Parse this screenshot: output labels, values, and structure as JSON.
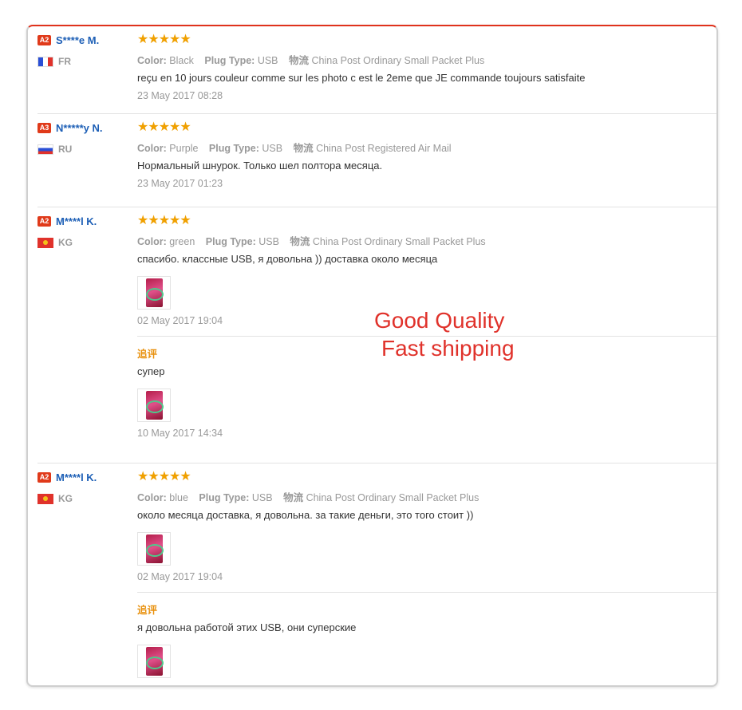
{
  "reviews": [
    {
      "level": "A2",
      "name": "S****e M.",
      "country": "FR",
      "flag": "fr",
      "stars": "★★★★★",
      "color_label": "Color:",
      "color": "Black",
      "plug_label": "Plug Type:",
      "plug": "USB",
      "ship_label": "物流",
      "ship": "China Post Ordinary Small Packet Plus",
      "text": "reçu en 10 jours couleur comme sur les photo c est le 2eme que JE commande toujours satisfaite",
      "date": "23 May 2017 08:28"
    },
    {
      "level": "A3",
      "name": "N*****y N.",
      "country": "RU",
      "flag": "ru",
      "stars": "★★★★★",
      "color_label": "Color:",
      "color": "Purple",
      "plug_label": "Plug Type:",
      "plug": "USB",
      "ship_label": "物流",
      "ship": "China Post Registered Air Mail",
      "text": "Нормальный шнурок. Только шел полтора месяца.",
      "date": "23 May 2017 01:23"
    },
    {
      "level": "A2",
      "name": "M****l K.",
      "country": "KG",
      "flag": "kg",
      "stars": "★★★★★",
      "color_label": "Color:",
      "color": "green",
      "plug_label": "Plug Type:",
      "plug": "USB",
      "ship_label": "物流",
      "ship": "China Post Ordinary Small Packet Plus",
      "text": "спасибо. классные USB, я довольна )) доставка около месяца",
      "date": "02 May 2017 19:04",
      "followup": {
        "label": "追评",
        "text": "супер",
        "date": "10 May 2017 14:34"
      }
    },
    {
      "level": "A2",
      "name": "M****l K.",
      "country": "KG",
      "flag": "kg",
      "stars": "★★★★★",
      "color_label": "Color:",
      "color": "blue",
      "plug_label": "Plug Type:",
      "plug": "USB",
      "ship_label": "物流",
      "ship": "China Post Ordinary Small Packet Plus",
      "text": "около месяца доставка, я довольна. за такие деньги, это того стоит ))",
      "date": "02 May 2017 19:04",
      "followup": {
        "label": "追评",
        "text": "я довольна работой этих USB, они суперские",
        "date": ""
      }
    }
  ],
  "overlay": {
    "line1": "Good Quality",
    "line2": "Fast shipping",
    "color": "#e0322b"
  }
}
